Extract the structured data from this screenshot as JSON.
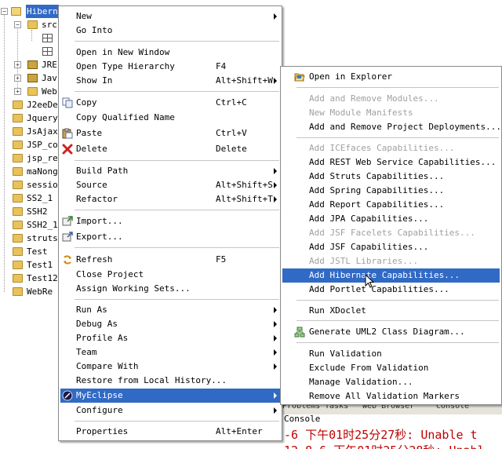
{
  "tree": {
    "items": [
      {
        "label": "Hibern",
        "selected": true,
        "icon": "project-folder-icon"
      },
      {
        "label": "src",
        "icon": "source-folder-icon"
      },
      {
        "label": "",
        "icon": "grid-icon"
      },
      {
        "label": "",
        "icon": "grid-icon"
      },
      {
        "label": "JRE",
        "icon": "library-icon"
      },
      {
        "label": "Jav",
        "icon": "library-icon"
      },
      {
        "label": "Web",
        "icon": "folder-icon"
      },
      {
        "label": "J2eeDe",
        "icon": "folder-icon"
      },
      {
        "label": "Jquery",
        "icon": "folder-icon"
      },
      {
        "label": "JsAjax",
        "icon": "folder-icon"
      },
      {
        "label": "JSP_co",
        "icon": "folder-icon"
      },
      {
        "label": "jsp_re",
        "icon": "folder-icon"
      },
      {
        "label": "maNong",
        "icon": "folder-icon"
      },
      {
        "label": "session",
        "icon": "folder-icon"
      },
      {
        "label": "SS2_1",
        "icon": "folder-icon"
      },
      {
        "label": "SSH2",
        "icon": "folder-icon"
      },
      {
        "label": "SSH2_1",
        "icon": "folder-icon"
      },
      {
        "label": "struts",
        "icon": "folder-icon"
      },
      {
        "label": "Test",
        "icon": "folder-icon"
      },
      {
        "label": "Test1",
        "icon": "folder-icon"
      },
      {
        "label": "Test12",
        "icon": "folder-icon"
      },
      {
        "label": "WebRe",
        "icon": "folder-icon"
      }
    ]
  },
  "main_menu": {
    "items": [
      {
        "label": "New",
        "submenu": true
      },
      {
        "label": "Go Into"
      },
      {
        "label": "Open in New Window"
      },
      {
        "label": "Open Type Hierarchy",
        "accel": "F4"
      },
      {
        "label": "Show In",
        "accel": "Alt+Shift+W",
        "submenu": true
      },
      {
        "label": "Copy",
        "accel": "Ctrl+C",
        "icon": "copy-icon"
      },
      {
        "label": "Copy Qualified Name"
      },
      {
        "label": "Paste",
        "accel": "Ctrl+V",
        "icon": "paste-icon"
      },
      {
        "label": "Delete",
        "accel": "Delete",
        "icon": "delete-icon"
      },
      {
        "label": "Build Path",
        "submenu": true
      },
      {
        "label": "Source",
        "accel": "Alt+Shift+S",
        "submenu": true
      },
      {
        "label": "Refactor",
        "accel": "Alt+Shift+T",
        "submenu": true
      },
      {
        "label": "Import...",
        "icon": "import-icon"
      },
      {
        "label": "Export...",
        "icon": "export-icon"
      },
      {
        "label": "Refresh",
        "accel": "F5",
        "icon": "refresh-icon"
      },
      {
        "label": "Close Project"
      },
      {
        "label": "Assign Working Sets..."
      },
      {
        "label": "Run As",
        "submenu": true
      },
      {
        "label": "Debug As",
        "submenu": true
      },
      {
        "label": "Profile As",
        "submenu": true
      },
      {
        "label": "Team",
        "submenu": true
      },
      {
        "label": "Compare With",
        "submenu": true
      },
      {
        "label": "Restore from Local History..."
      },
      {
        "label": "MyEclipse",
        "submenu": true,
        "highlight": true,
        "icon": "myeclipse-icon"
      },
      {
        "label": "Configure",
        "submenu": true
      },
      {
        "label": "Properties",
        "accel": "Alt+Enter"
      }
    ]
  },
  "sub_menu": {
    "items": [
      {
        "label": "Open in Explorer",
        "icon": "folder-open-icon"
      },
      {
        "label": "Add and Remove Modules...",
        "disabled": true
      },
      {
        "label": "New Module Manifests",
        "disabled": true
      },
      {
        "label": "Add and Remove Project Deployments..."
      },
      {
        "label": "Add ICEfaces Capabilities...",
        "disabled": true
      },
      {
        "label": "Add REST Web Service Capabilities..."
      },
      {
        "label": "Add Struts Capabilities..."
      },
      {
        "label": "Add Spring Capabilities..."
      },
      {
        "label": "Add Report Capabilities..."
      },
      {
        "label": "Add JPA Capabilities..."
      },
      {
        "label": "Add JSF Facelets Capabilities...",
        "disabled": true
      },
      {
        "label": "Add JSF Capabilities..."
      },
      {
        "label": "Add JSTL Libraries...",
        "disabled": true
      },
      {
        "label": "Add Hibernate Capabilities...",
        "highlight": true
      },
      {
        "label": "Add Portlet Capabilities..."
      },
      {
        "label": "Run XDoclet"
      },
      {
        "label": "Generate UML2 Class Diagram...",
        "icon": "uml-diagram-icon"
      },
      {
        "label": "Run Validation"
      },
      {
        "label": "Exclude From Validation"
      },
      {
        "label": "Manage Validation..."
      },
      {
        "label": "Remove All Validation Markers"
      }
    ]
  },
  "console": {
    "tab_label": "Console",
    "line1": "-6 下午01时25分27秒: Unable t",
    "line2": "12-8-6 下午01时25分28秒: Unabl"
  },
  "views_bar": {
    "tabs": [
      "Problems",
      "Tasks",
      "Web Browser",
      "Console"
    ]
  }
}
